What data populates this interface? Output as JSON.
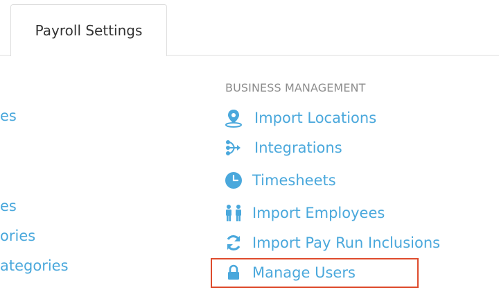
{
  "tabs": [
    {
      "label": "Payroll Settings"
    }
  ],
  "left_column": [
    {
      "label": "es"
    },
    {
      "label": "es"
    },
    {
      "label": "ories"
    },
    {
      "label": "ategories"
    }
  ],
  "business_management": {
    "heading": "BUSINESS MANAGEMENT",
    "items": [
      {
        "label": "Import Locations",
        "icon": "location-pin-icon"
      },
      {
        "label": "Integrations",
        "icon": "integrations-icon"
      },
      {
        "label": "Timesheets",
        "icon": "clock-icon"
      },
      {
        "label": "Import Employees",
        "icon": "people-icon"
      },
      {
        "label": "Import Pay Run Inclusions",
        "icon": "refresh-icon"
      },
      {
        "label": "Manage Users",
        "icon": "lock-icon"
      }
    ]
  },
  "colors": {
    "link": "#4aa8dc",
    "heading": "#8c8c8c",
    "highlight": "#de4b2c",
    "border": "#dedede"
  }
}
